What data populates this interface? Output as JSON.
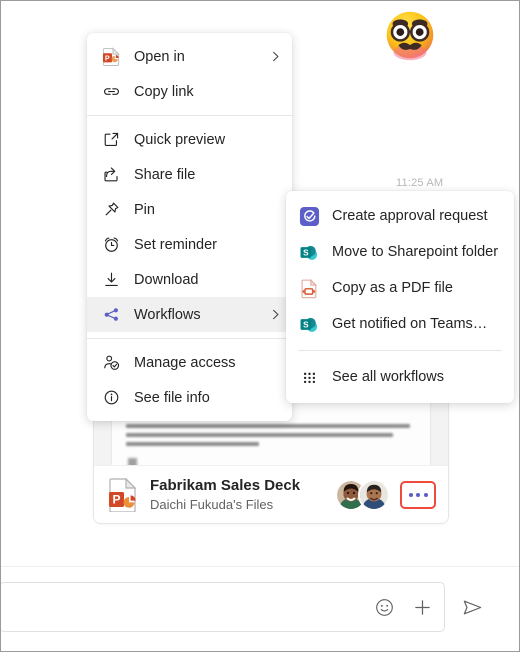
{
  "window": {
    "app": "Microsoft Teams file message",
    "background_color": "#ffffff",
    "border_color": "#9a9a9a"
  },
  "message": {
    "sticker_icon": "disguised-face-emoji",
    "timestamp": "11:25 AM"
  },
  "file_card": {
    "icon": "powerpoint-file-icon",
    "title": "Fabrikam Sales Deck",
    "subtitle": "Daichi Fukuda's Files",
    "preview_icon": "document-preview-blurred",
    "avatars": [
      {
        "name": "avatar-person-1"
      },
      {
        "name": "avatar-person-2"
      }
    ],
    "more_button": {
      "label": "...",
      "icon": "more-options-icon",
      "outline_color": "#ef4b3c",
      "dot_color": "#5b5fc7"
    }
  },
  "context_menu": {
    "groups": [
      {
        "items": [
          {
            "label": "Open in",
            "icon": "powerpoint-icon",
            "submenu": true
          },
          {
            "label": "Copy link",
            "icon": "link-icon",
            "submenu": false
          }
        ]
      },
      {
        "items": [
          {
            "label": "Quick preview",
            "icon": "quick-preview-icon",
            "submenu": false
          },
          {
            "label": "Share file",
            "icon": "share-icon",
            "submenu": false
          },
          {
            "label": "Pin",
            "icon": "pin-icon",
            "submenu": false
          },
          {
            "label": "Set reminder",
            "icon": "alarm-clock-icon",
            "submenu": false
          },
          {
            "label": "Download",
            "icon": "download-icon",
            "submenu": false
          },
          {
            "label": "Workflows",
            "icon": "workflows-icon",
            "submenu": true,
            "selected": true
          }
        ]
      },
      {
        "items": [
          {
            "label": "Manage access",
            "icon": "manage-access-icon",
            "submenu": false
          },
          {
            "label": "See file info",
            "icon": "info-icon",
            "submenu": false
          }
        ]
      }
    ]
  },
  "submenu": {
    "title": "Workflows",
    "items": [
      {
        "label": "Create approval request",
        "icon": "approvals-icon",
        "color": "#5b5fc7"
      },
      {
        "label": "Move to Sharepoint folder",
        "icon": "sharepoint-icon",
        "color": "#038387"
      },
      {
        "label": "Copy as a PDF file",
        "icon": "pdf-file-icon",
        "color": "#d65532"
      },
      {
        "label": "Get notified on Teams…",
        "icon": "sharepoint-icon",
        "color": "#038387"
      }
    ],
    "footer": {
      "label": "See all workflows",
      "icon": "grid-dots-icon"
    }
  },
  "compose": {
    "placeholder": "",
    "value": "",
    "emoji_label": "emoji-icon",
    "attach_label": "plus-icon",
    "send_label": "send-icon"
  }
}
